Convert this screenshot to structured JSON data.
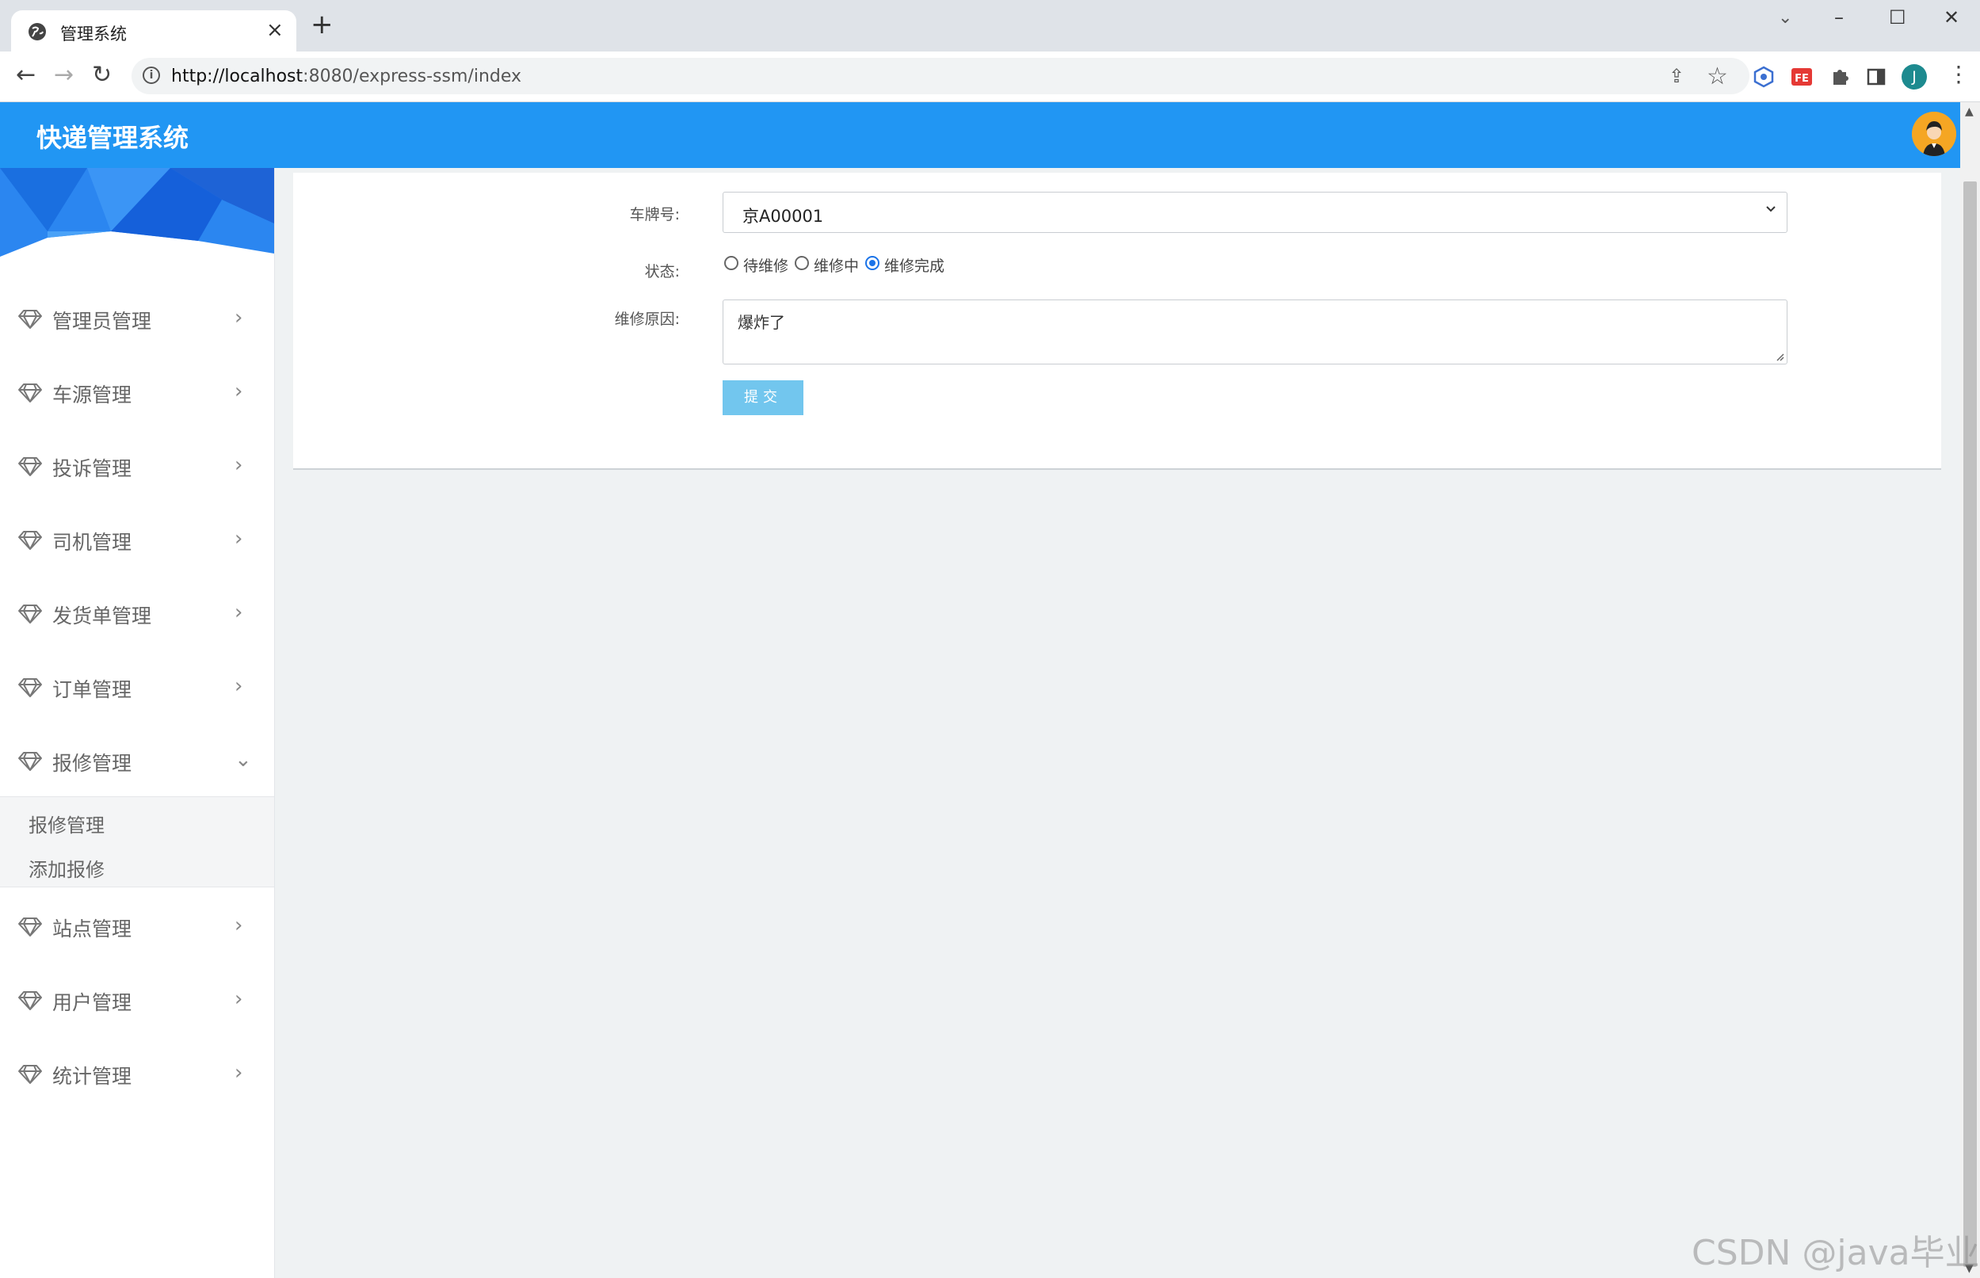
{
  "browser": {
    "tab_title": "管理系统",
    "url_host": "http://localhost",
    "url_rest": ":8080/express-ssm/index",
    "profile_initial": "J",
    "close_tab_glyph": "×",
    "new_tab_glyph": "+"
  },
  "app": {
    "title": "快递管理系统"
  },
  "sidebar": {
    "items": [
      {
        "label": "管理员管理",
        "expanded": false
      },
      {
        "label": "车源管理",
        "expanded": false
      },
      {
        "label": "投诉管理",
        "expanded": false
      },
      {
        "label": "司机管理",
        "expanded": false
      },
      {
        "label": "发货单管理",
        "expanded": false
      },
      {
        "label": "订单管理",
        "expanded": false
      },
      {
        "label": "报修管理",
        "expanded": true
      },
      {
        "label": "站点管理",
        "expanded": false
      },
      {
        "label": "用户管理",
        "expanded": false
      },
      {
        "label": "统计管理",
        "expanded": false
      }
    ],
    "submenu": [
      {
        "label": "报修管理"
      },
      {
        "label": "添加报修"
      }
    ]
  },
  "form": {
    "plate_label": "车牌号:",
    "plate_value": "京A00001",
    "status_label": "状态:",
    "status_options": [
      "待维修",
      "维修中",
      "维修完成"
    ],
    "status_selected": "维修完成",
    "reason_label": "维修原因:",
    "reason_value": "爆炸了",
    "submit_label": "提交"
  },
  "watermark": "CSDN @java毕业",
  "colors": {
    "header": "#2196f3",
    "submit": "#72c6ee",
    "background": "#eff2f3"
  }
}
